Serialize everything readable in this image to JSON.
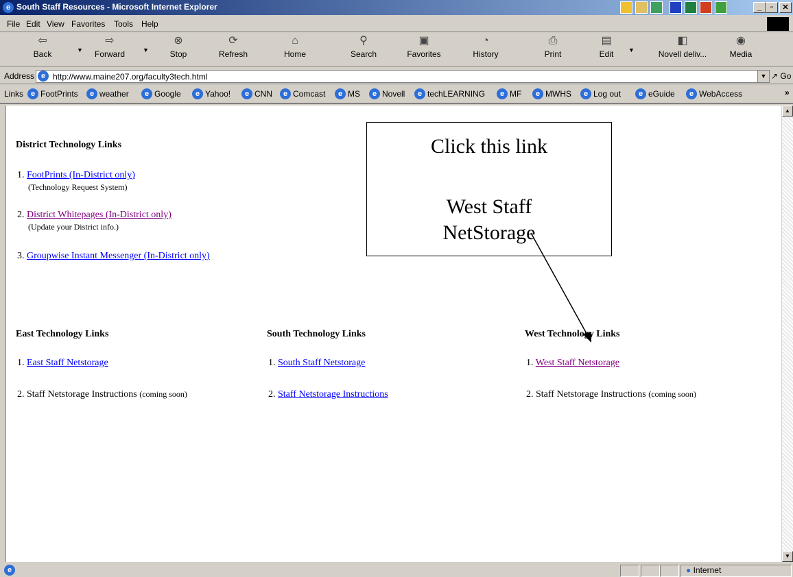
{
  "window": {
    "title": "South Staff Resources - Microsoft Internet Explorer"
  },
  "menu": [
    "File",
    "Edit",
    "View",
    "Favorites",
    "Tools",
    "Help"
  ],
  "toolbar": [
    {
      "label": "Back",
      "icon": "back-arrow-icon"
    },
    {
      "label": "Forward",
      "icon": "forward-arrow-icon"
    },
    {
      "label": "Stop",
      "icon": "stop-icon"
    },
    {
      "label": "Refresh",
      "icon": "refresh-icon"
    },
    {
      "label": "Home",
      "icon": "home-icon"
    },
    {
      "label": "Search",
      "icon": "search-icon"
    },
    {
      "label": "Favorites",
      "icon": "favorites-icon"
    },
    {
      "label": "History",
      "icon": "history-icon"
    },
    {
      "label": "Print",
      "icon": "print-icon"
    },
    {
      "label": "Edit",
      "icon": "edit-icon"
    },
    {
      "label": "Novell deliv...",
      "icon": "novell-icon"
    },
    {
      "label": "Media",
      "icon": "media-icon"
    }
  ],
  "address": {
    "label": "Address",
    "url": "http://www.maine207.org/faculty3tech.html",
    "go": "Go"
  },
  "links": {
    "label": "Links",
    "items": [
      "FootPrints",
      "weather",
      "Google",
      "Yahoo!",
      "CNN",
      "Comcast",
      "MS",
      "Novell",
      "techLEARNING",
      "MF",
      "MWHS",
      "Log out",
      "eGuide",
      "WebAccess"
    ]
  },
  "page": {
    "district": {
      "title": "District Technology Links",
      "items": [
        {
          "num": "1.",
          "link": "FootPrints (In-District only)",
          "note": "(Technology Request System)"
        },
        {
          "num": "2.",
          "link": "District Whitepages (In-District only)",
          "note": "(Update your District info.)"
        },
        {
          "num": "3.",
          "link": "Groupwise Instant Messenger (In-District only)",
          "note": ""
        }
      ]
    },
    "east": {
      "title": "East Technology Links",
      "item1_num": "1.",
      "item1_link": "East Staff Netstorage",
      "item2_num": "2.",
      "item2_text": "Staff Netstorage Instructions",
      "item2_note": "(coming soon)"
    },
    "south": {
      "title": "South Technology Links",
      "item1_num": "1.",
      "item1_link": "South Staff Netstorage",
      "item2_num": "2.",
      "item2_link": "Staff Netstorage Instructions"
    },
    "west": {
      "title": "West Technology Links",
      "item1_num": "1.",
      "item1_link": "West Staff Netstorage",
      "item2_num": "2.",
      "item2_text": "Staff Netstorage Instructions",
      "item2_note": "(coming soon)"
    }
  },
  "callout": {
    "line1": "Click this link",
    "line2": "West Staff",
    "line3": "NetStorage"
  },
  "status": {
    "zone": "Internet"
  },
  "colors": {
    "link": "#0000ff",
    "visited": "#800080",
    "titlebar_start": "#0a246a",
    "titlebar_end": "#a6caf0"
  }
}
